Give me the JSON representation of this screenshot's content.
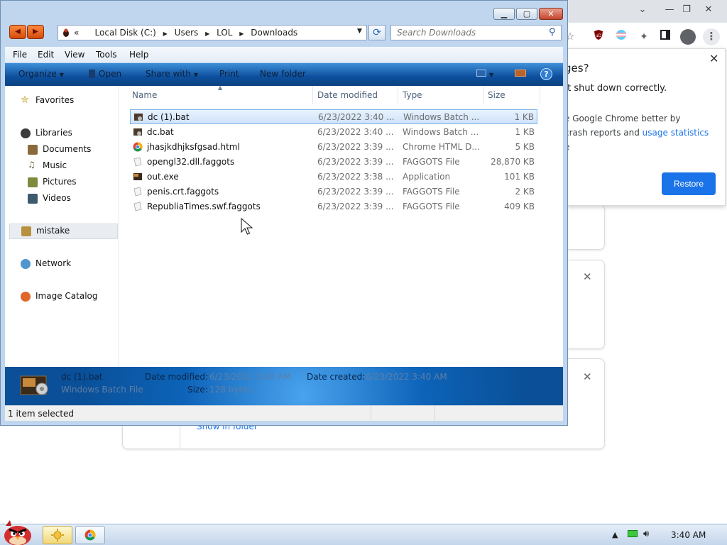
{
  "chrome": {
    "restore": {
      "title": "ges?",
      "subtitle": "’t shut down correctly.",
      "help_line1": "e Google Chrome better by",
      "help_line2_pre": "crash reports and ",
      "help_link": "usage statistics",
      "help_line3": "e",
      "button": "Restore",
      "close": "✕"
    },
    "downloads": {
      "close": "✕",
      "show_in_folder": "Show in folder"
    }
  },
  "explorer": {
    "window_buttons": {
      "minimize": "▁",
      "maximize": "▢",
      "close": "✕"
    },
    "address": {
      "prefix": "«",
      "crumbs": [
        "Local Disk (C:)",
        "Users",
        "LOL",
        "Downloads"
      ]
    },
    "search": {
      "placeholder": "Search Downloads"
    },
    "menu": [
      "File",
      "Edit",
      "View",
      "Tools",
      "Help"
    ],
    "commands": {
      "organize": "Organize",
      "open": "Open",
      "share_with": "Share with",
      "print": "Print",
      "new_folder": "New folder"
    },
    "nav": {
      "favorites": "Favorites",
      "libraries": "Libraries",
      "documents": "Documents",
      "music": "Music",
      "pictures": "Pictures",
      "videos": "Videos",
      "mistake": "mistake",
      "network": "Network",
      "image_catalog": "Image Catalog"
    },
    "columns": {
      "name": "Name",
      "date": "Date modified",
      "type": "Type",
      "size": "Size"
    },
    "files": [
      {
        "name": "dc (1).bat",
        "date": "6/23/2022 3:40 ...",
        "type": "Windows Batch ...",
        "size": "1 KB",
        "icon": "batch-file-icon"
      },
      {
        "name": "dc.bat",
        "date": "6/23/2022 3:40 ...",
        "type": "Windows Batch ...",
        "size": "1 KB",
        "icon": "batch-file-icon"
      },
      {
        "name": "jhasjkdhjksfgsad.html",
        "date": "6/23/2022 3:39 ...",
        "type": "Chrome HTML D...",
        "size": "5 KB",
        "icon": "chrome-icon"
      },
      {
        "name": "opengl32.dll.faggots",
        "date": "6/23/2022 3:39 ...",
        "type": "FAGGOTS File",
        "size": "28,870 KB",
        "icon": "generic-file-icon"
      },
      {
        "name": "out.exe",
        "date": "6/23/2022 3:38 ...",
        "type": "Application",
        "size": "101 KB",
        "icon": "application-icon"
      },
      {
        "name": "penis.crt.faggots",
        "date": "6/23/2022 3:39 ...",
        "type": "FAGGOTS File",
        "size": "2 KB",
        "icon": "generic-file-icon"
      },
      {
        "name": "RepubliaTimes.swf.faggots",
        "date": "6/23/2022 3:39 ...",
        "type": "FAGGOTS File",
        "size": "409 KB",
        "icon": "generic-file-icon"
      }
    ],
    "details": {
      "name": "dc (1).bat",
      "type": "Windows Batch File",
      "date_modified_label": "Date modified:",
      "date_modified": "6/23/2022 3:40 AM",
      "date_created_label": "Date created:",
      "date_created": "6/23/2022 3:40 AM",
      "size_label": "Size:",
      "size": "128 bytes"
    },
    "status": "1 item selected"
  },
  "taskbar": {
    "clock": "3:40 AM"
  }
}
